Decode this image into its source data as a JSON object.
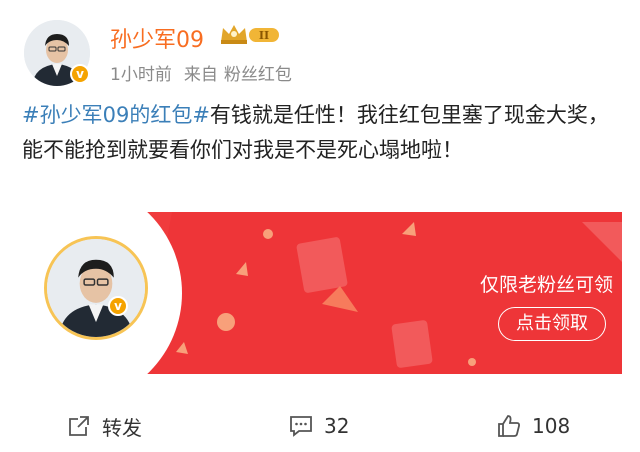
{
  "post": {
    "author_name": "孙少军09",
    "level_badge": "II",
    "time": "1小时前",
    "source_prefix": "来自",
    "source": "粉丝红包",
    "hashtag": "#孙少军09的红包#",
    "body": "有钱就是任性！我往红包里塞了现金大奖，能不能抢到就要看你们对我是不是死心塌地啦！"
  },
  "card": {
    "label": "仅限老粉丝可领",
    "button": "点击领取"
  },
  "actions": {
    "repost_label": "转发",
    "comment_count": "32",
    "like_count": "108"
  },
  "badge_letter": "v",
  "colors": {
    "name": "#f86d21",
    "hashtag": "#3b7fb8",
    "card_red": "#f03b3d",
    "gold": "#f5a300"
  }
}
